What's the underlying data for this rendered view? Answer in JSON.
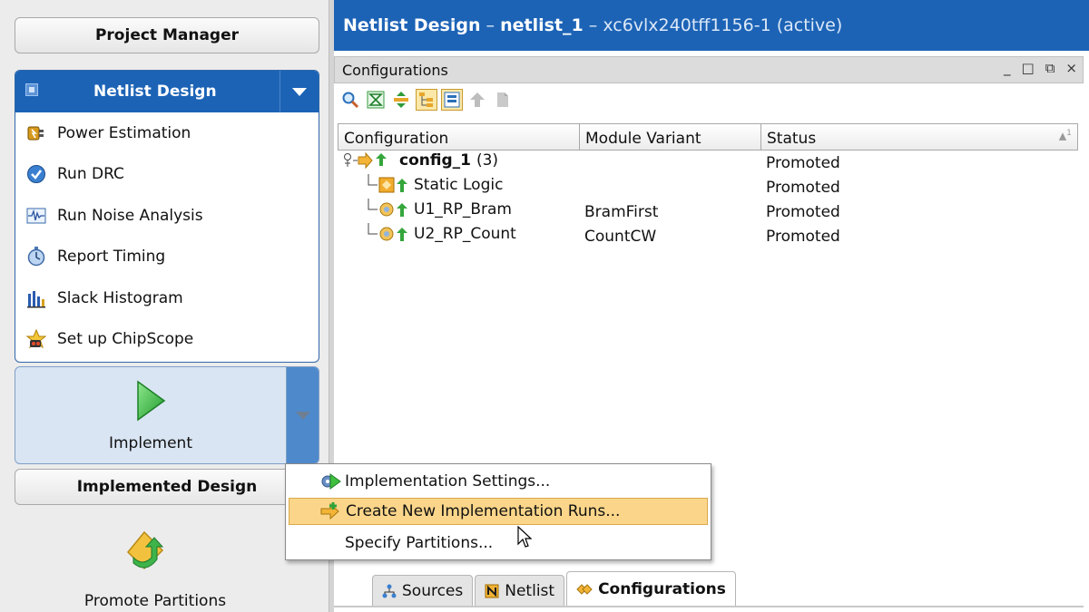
{
  "left_nav": {
    "project_manager": "Project Manager",
    "section_title": "Netlist Design",
    "items": [
      {
        "label": "Power Estimation",
        "icon": "power-estimation-icon"
      },
      {
        "label": "Run DRC",
        "icon": "check-circle-icon"
      },
      {
        "label": "Run Noise Analysis",
        "icon": "waveform-icon"
      },
      {
        "label": "Report Timing",
        "icon": "stopwatch-icon"
      },
      {
        "label": "Slack Histogram",
        "icon": "histogram-icon"
      },
      {
        "label": "Set up ChipScope",
        "icon": "chipscope-icon"
      }
    ],
    "implement_label": "Implement",
    "implemented_design": "Implemented Design",
    "promote_partitions": "Promote Partitions"
  },
  "title_bar": {
    "prefix": "Netlist Design",
    "sep1": " – ",
    "name": "netlist_1",
    "sep2": " – ",
    "device": "xc6vlx240tff1156-1 (active)"
  },
  "panel": {
    "title": "Configurations",
    "window_controls": [
      "_",
      "□",
      "⧉",
      "×"
    ],
    "table": {
      "columns": [
        "Configuration",
        "Module Variant",
        "Status"
      ],
      "sort_indicator": "1",
      "rows": [
        {
          "name": "config_1",
          "count": "(3)",
          "variant": "",
          "status": "Promoted"
        },
        {
          "name": "Static Logic",
          "variant": "",
          "status": "Promoted"
        },
        {
          "name": "U1_RP_Bram",
          "variant": "BramFirst",
          "status": "Promoted"
        },
        {
          "name": "U2_RP_Count",
          "variant": "CountCW",
          "status": "Promoted"
        }
      ]
    }
  },
  "bottom_tabs": [
    {
      "label": "Sources",
      "icon": "hierarchy-icon"
    },
    {
      "label": "Netlist",
      "icon": "netlist-icon"
    },
    {
      "label": "Configurations",
      "icon": "configurations-icon",
      "active": true
    }
  ],
  "context_menu": {
    "items": [
      {
        "label": "Implementation Settings...",
        "icon": "implementation-settings-icon"
      },
      {
        "label": "Create New Implementation Runs...",
        "icon": "create-run-icon",
        "highlighted": true
      },
      {
        "label": "Specify Partitions..."
      }
    ]
  },
  "colors": {
    "accent_blue": "#1c63b6",
    "menu_highlight": "#fbd68a",
    "implement_play": "#3fbf3f"
  }
}
